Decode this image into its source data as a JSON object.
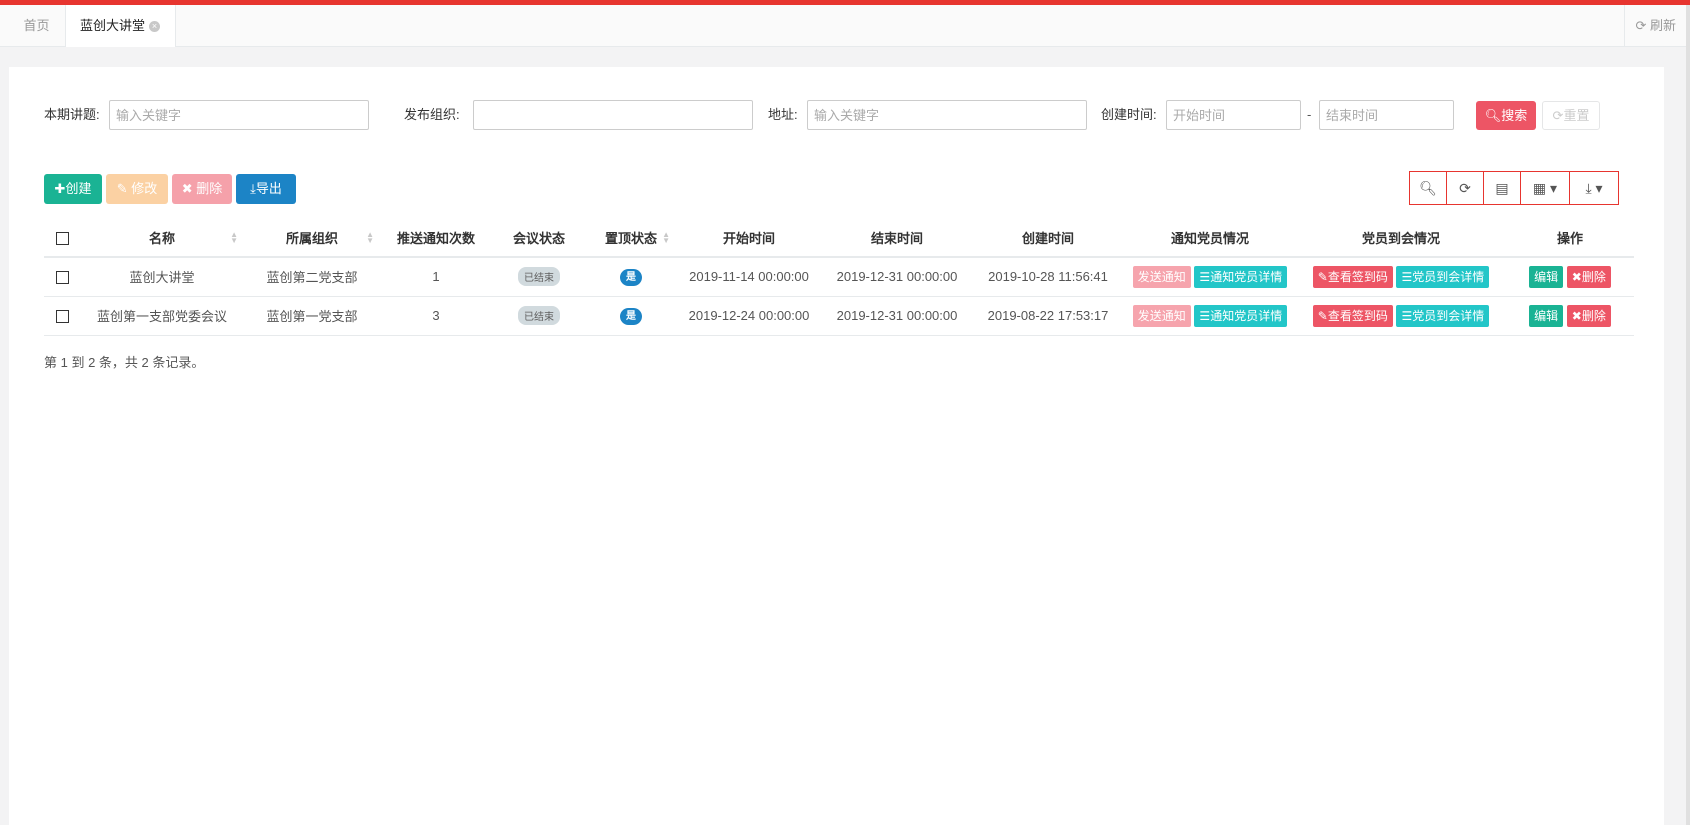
{
  "tabs": [
    {
      "label": "首页"
    },
    {
      "label": "蓝创大讲堂",
      "close": "×"
    }
  ],
  "refresh_label": "刷新",
  "search": {
    "topic_label": "本期讲题:",
    "topic_placeholder": "输入关键字",
    "org_label": "发布组织:",
    "org_value": "",
    "address_label": "地址:",
    "address_placeholder": "输入关键字",
    "created_label": "创建时间:",
    "start_placeholder": "开始时间",
    "end_placeholder": "结束时间",
    "dash": "-",
    "search_btn": "搜索",
    "reset_btn": "重置"
  },
  "toolbar": {
    "create": "创建",
    "edit": "修改",
    "delete": "删除",
    "export": "导出"
  },
  "table": {
    "headers": [
      "名称",
      "所属组织",
      "推送通知次数",
      "会议状态",
      "置顶状态",
      "开始时间",
      "结束时间",
      "创建时间",
      "通知党员情况",
      "党员到会情况",
      "操作"
    ],
    "rows": [
      {
        "name": "蓝创大讲堂",
        "org": "蓝创第二党支部",
        "count": "1",
        "status": "已结束",
        "top": "是",
        "start": "2019-11-14 00:00:00",
        "end": "2019-12-31 00:00:00",
        "created": "2019-10-28 11:56:41"
      },
      {
        "name": "蓝创第一支部党委会议",
        "org": "蓝创第一党支部",
        "count": "3",
        "status": "已结束",
        "top": "是",
        "start": "2019-12-24 00:00:00",
        "end": "2019-12-31 00:00:00",
        "created": "2019-08-22 17:53:17"
      }
    ],
    "row_buttons": {
      "send_notice": "发送通知",
      "notice_detail": "通知党员详情",
      "view_code": "查看签到码",
      "attend_detail": "党员到会详情",
      "edit": "编辑",
      "delete": "删除"
    }
  },
  "pagination_text": "第 1 到 2 条，共 2 条记录。"
}
